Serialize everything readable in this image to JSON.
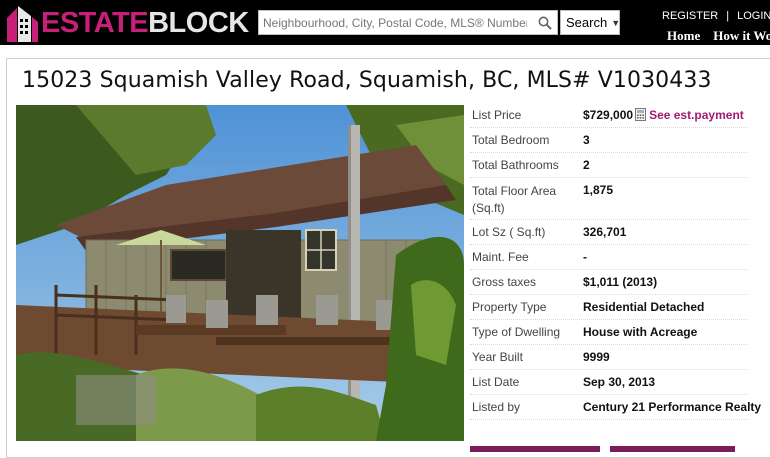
{
  "brand": {
    "name_a": "ESTATE",
    "name_b": "BLOCK"
  },
  "search": {
    "placeholder": "Neighbourhood, City, Postal Code, MLS® Number",
    "button_label": "Search"
  },
  "auth": {
    "register": "REGISTER",
    "login": "LOGIN",
    "separator": "|"
  },
  "nav": {
    "home": "Home",
    "how_it_works": "How it Works"
  },
  "listing": {
    "title": "15023 Squamish Valley Road, Squamish, BC, MLS# V1030433",
    "photo_alt": "Listing photo",
    "est_payment_label": "See est.payment",
    "specs": [
      {
        "label": "List Price",
        "value": "$729,000"
      },
      {
        "label": "Total Bedroom",
        "value": "3"
      },
      {
        "label": "Total Bathrooms",
        "value": "2"
      },
      {
        "label": "Total Floor Area (Sq.ft)",
        "value": "1,875"
      },
      {
        "label": "Lot Sz ( Sq.ft)",
        "value": "326,701"
      },
      {
        "label": "Maint. Fee",
        "value": "-"
      },
      {
        "label": "Gross taxes",
        "value": "$1,011 (2013)"
      },
      {
        "label": "Property Type",
        "value": "Residential Detached"
      },
      {
        "label": "Type of Dwelling",
        "value": "House with Acreage"
      },
      {
        "label": "Year Built",
        "value": "9999"
      },
      {
        "label": "List Date",
        "value": "Sep 30, 2013"
      },
      {
        "label": "Listed by",
        "value": "Century 21 Performance Realty"
      }
    ]
  },
  "colors": {
    "brand_magenta": "#c8207a",
    "header_bg": "#000000",
    "link": "#a11b73"
  }
}
